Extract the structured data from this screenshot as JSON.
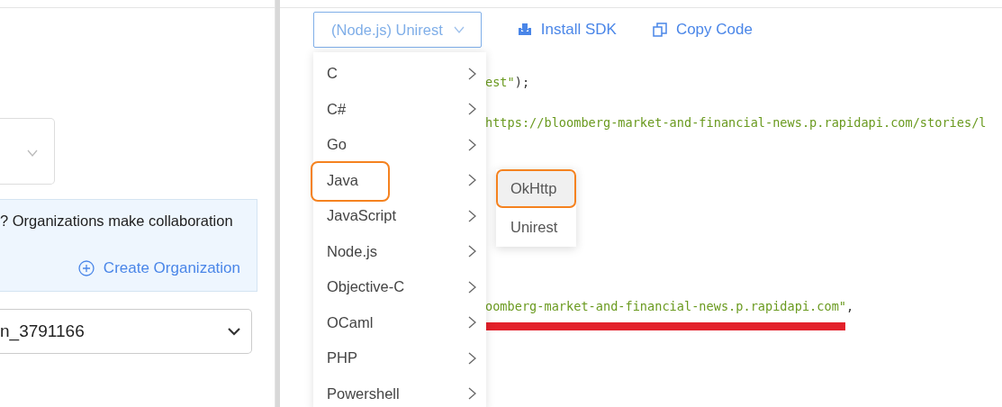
{
  "left_panel": {
    "info_box": {
      "message": "? Organizations make collaboration",
      "link": "Create Organization"
    },
    "account_select": {
      "value": "n_3791166"
    }
  },
  "toolbar": {
    "language_button": "(Node.js) Unirest",
    "actions": [
      {
        "label": "Install SDK",
        "kind": "install"
      },
      {
        "label": "Copy Code",
        "kind": "copy"
      }
    ]
  },
  "code_lines": [
    {
      "kind": "code",
      "segments": [
        {
          "text": "est\"",
          "kind": "string"
        },
        {
          "text": ");",
          "kind": "plain"
        }
      ]
    },
    {
      "kind": "code",
      "segments": [
        {
          "text": "https://bloomberg-market-and-financial-news.p.rapidapi.com/stories/l",
          "kind": "string"
        }
      ]
    },
    {
      "kind": "code",
      "segments": [
        {
          "text": "oomberg-market-and-financial-news.p.rapidapi.com\"",
          "kind": "string"
        },
        {
          "text": ",",
          "kind": "plain"
        }
      ]
    },
    {
      "kind": "redacted"
    }
  ],
  "language_menu": [
    {
      "label": "C",
      "annotated": false
    },
    {
      "label": "C#",
      "annotated": false
    },
    {
      "label": "Go",
      "annotated": false
    },
    {
      "label": "Java",
      "annotated": true
    },
    {
      "label": "JavaScript",
      "annotated": false
    },
    {
      "label": "Node.js",
      "annotated": false
    },
    {
      "label": "Objective-C",
      "annotated": false
    },
    {
      "label": "OCaml",
      "annotated": false
    },
    {
      "label": "PHP",
      "annotated": false
    },
    {
      "label": "Powershell",
      "annotated": false
    }
  ],
  "submenu": [
    {
      "label": "OkHttp",
      "selected": true,
      "annotated": true
    },
    {
      "label": "Unirest",
      "selected": false,
      "annotated": false
    }
  ]
}
